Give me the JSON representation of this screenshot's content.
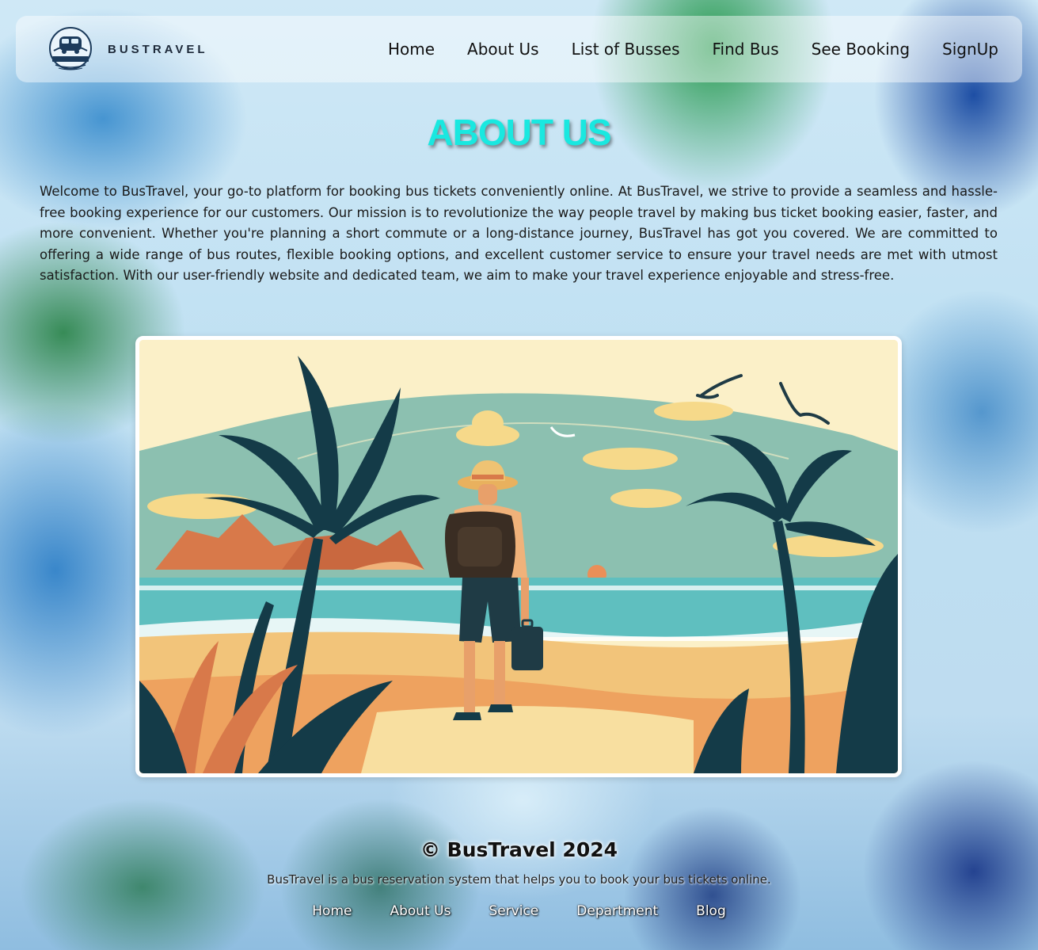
{
  "header": {
    "brand": "BUSTRAVEL",
    "logo_icon": "bus-logo-icon",
    "nav": [
      {
        "label": "Home"
      },
      {
        "label": "About Us"
      },
      {
        "label": "List of Busses"
      },
      {
        "label": "Find Bus"
      },
      {
        "label": "See Booking"
      },
      {
        "label": "SignUp"
      }
    ]
  },
  "main": {
    "title": "ABOUT US",
    "intro": "Welcome to BusTravel, your go-to platform for booking bus tickets conveniently online. At BusTravel, we strive to provide a seamless and hassle-free booking experience for our customers. Our mission is to revolutionize the way people travel by making bus ticket booking easier, faster, and more convenient. Whether you're planning a short commute or a long-distance journey, BusTravel has got you covered. We are committed to offering a wide range of bus routes, flexible booking options, and excellent customer service to ensure your travel needs are met with utmost satisfaction. With our user-friendly website and dedicated team, we aim to make your travel experience enjoyable and stress-free."
  },
  "footer": {
    "title": "© BusTravel 2024",
    "tagline": "BusTravel is a bus reservation system that helps you to book your bus tickets online.",
    "links": [
      {
        "label": "Home"
      },
      {
        "label": "About Us"
      },
      {
        "label": "Service"
      },
      {
        "label": "Department"
      },
      {
        "label": "Blog"
      }
    ]
  },
  "colors": {
    "title_accent": "#19e8e0",
    "nav_background": "rgba(255,255,255,0.45)"
  }
}
